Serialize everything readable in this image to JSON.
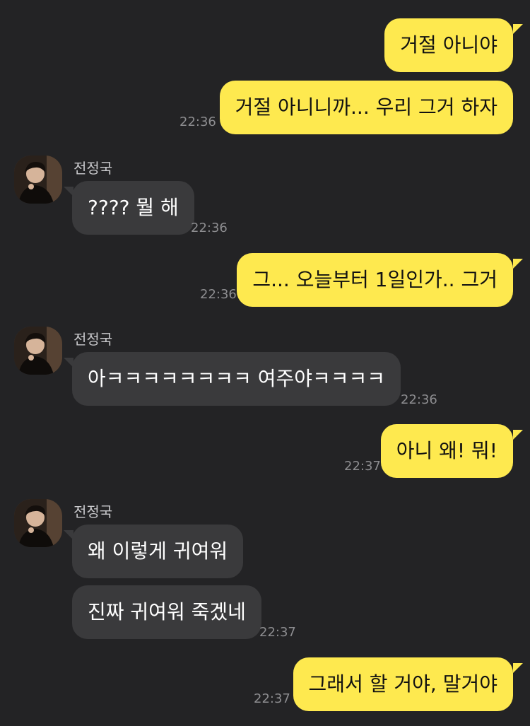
{
  "contact": {
    "name": "전정국"
  },
  "messages": [
    {
      "sender": "me",
      "text": "거절 아니야"
    },
    {
      "sender": "me",
      "text": "거절 아니니까... 우리 그거 하자",
      "time": "22:36"
    },
    {
      "sender": "them",
      "text": "???? 뭘 해",
      "time": "22:36"
    },
    {
      "sender": "me",
      "text": "그... 오늘부터 1일인가.. 그거",
      "time": "22:36"
    },
    {
      "sender": "them",
      "text": "아ㅋㅋㅋㅋㅋㅋㅋㅋ 여주야ㅋㅋㅋㅋ",
      "time": "22:36"
    },
    {
      "sender": "me",
      "text": "아니 왜! 뭐!",
      "time": "22:37"
    },
    {
      "sender": "them",
      "text": "왜 이렇게 귀여워"
    },
    {
      "sender": "them",
      "text": "진짜 귀여워 죽겠네",
      "time": "22:37"
    },
    {
      "sender": "me",
      "text": "그래서 할 거야, 말거야",
      "time": "22:37"
    }
  ],
  "colors": {
    "background": "#232325",
    "my_bubble": "#fee94f",
    "their_bubble": "#3a3a3c",
    "timestamp": "#8d8d90"
  }
}
